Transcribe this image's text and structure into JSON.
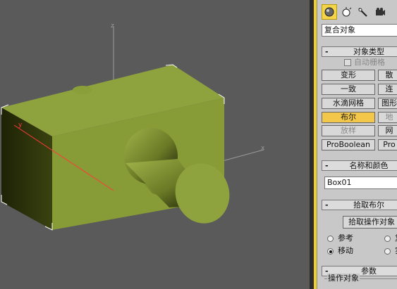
{
  "colors": {
    "accent": "#f1ce2d",
    "selected_button": "#f3c84a",
    "object_color": "#8ea23e",
    "panel_bg": "#c8c8c8",
    "viewport_bg": "#5a5a5a"
  },
  "viewport": {
    "axis_labels": {
      "z": "z",
      "y": "y",
      "x": "x"
    },
    "object": "box-with-cylinder (boolean operands)"
  },
  "command_panel": {
    "tabs": [
      {
        "icon": "sphere-icon",
        "active": true
      },
      {
        "icon": "light-icon",
        "active": false
      },
      {
        "icon": "wand-icon",
        "active": false
      },
      {
        "icon": "camera-icon",
        "active": false
      }
    ],
    "category_dropdown": "复合对象",
    "object_type_rollout": {
      "title": "对象类型",
      "autogrid_label": "自动栅格",
      "buttons_left": [
        "变形",
        "一致",
        "水滴网格",
        "布尔",
        "放样",
        "ProBoolean"
      ],
      "buttons_right": [
        "散",
        "连",
        "图形",
        "地",
        "网",
        "Pro"
      ]
    },
    "name_color_rollout": {
      "title": "名称和颜色",
      "name_value": "Box01"
    },
    "pick_boolean_rollout": {
      "title": "拾取布尔",
      "pick_button": "拾取操作对象",
      "radio_ref": "参考",
      "radio_move": "移动",
      "radio_copy_short": "复",
      "radio_inst_short": "实"
    },
    "params_rollout": {
      "title": "参数",
      "group_label": "操作对象"
    }
  }
}
